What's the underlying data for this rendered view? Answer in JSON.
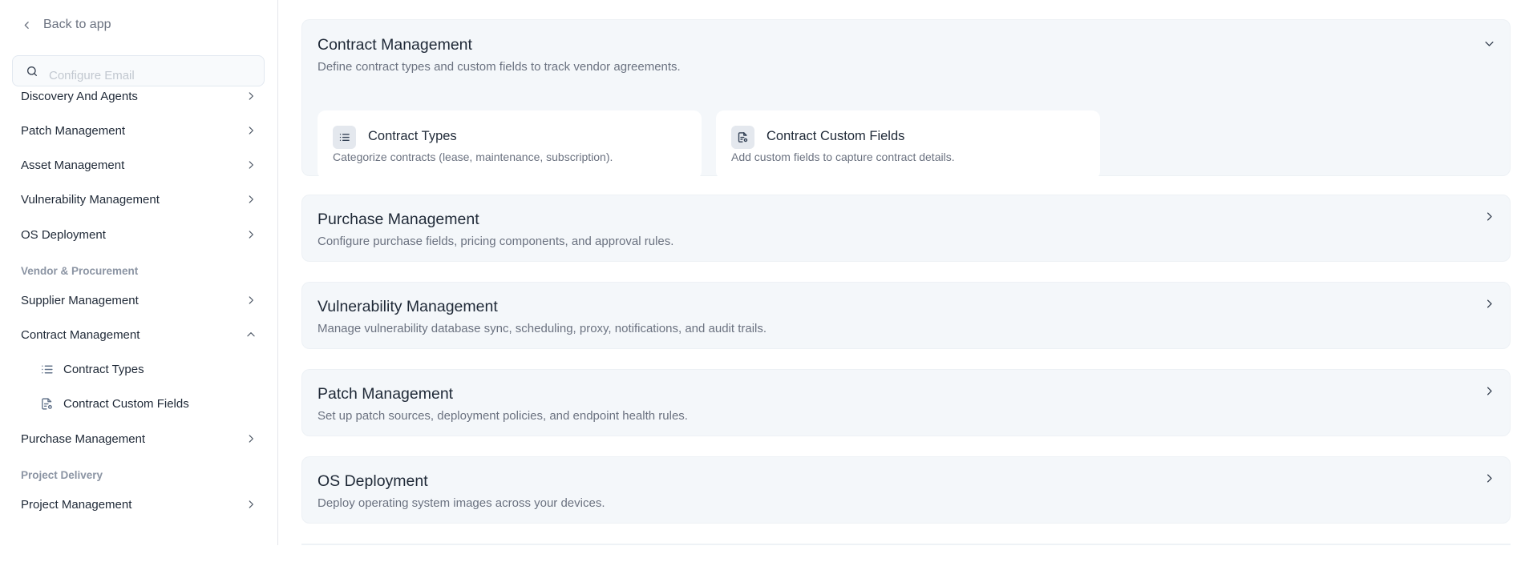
{
  "sidebar": {
    "back_label": "Back to app",
    "search_placeholder": "Configure Email",
    "items_top": [
      {
        "label": "Discovery And Agents"
      },
      {
        "label": "Patch Management"
      },
      {
        "label": "Asset Management"
      },
      {
        "label": "Vulnerability Management"
      },
      {
        "label": "OS Deployment"
      }
    ],
    "section_vendor": "Vendor & Procurement",
    "supplier": "Supplier Management",
    "contract": "Contract Management",
    "contract_sub": [
      {
        "label": "Contract Types",
        "icon": "list-icon"
      },
      {
        "label": "Contract Custom Fields",
        "icon": "file-settings-icon"
      }
    ],
    "purchase": "Purchase Management",
    "section_project": "Project Delivery",
    "project": "Project Management"
  },
  "main": {
    "panels": [
      {
        "title": "Contract Management",
        "description": "Define contract types and custom fields to track vendor agreements.",
        "expanded": true,
        "cards": [
          {
            "title": "Contract Types",
            "description": "Categorize contracts (lease, maintenance, subscription).",
            "icon": "list-icon"
          },
          {
            "title": "Contract Custom Fields",
            "description": "Add custom fields to capture contract details.",
            "icon": "file-settings-icon"
          }
        ]
      },
      {
        "title": "Purchase Management",
        "description": "Configure purchase fields, pricing components, and approval rules.",
        "expanded": false
      },
      {
        "title": "Vulnerability Management",
        "description": "Manage vulnerability database sync, scheduling, proxy, notifications, and audit trails.",
        "expanded": false
      },
      {
        "title": "Patch Management",
        "description": "Set up patch sources, deployment policies, and endpoint health rules.",
        "expanded": false
      },
      {
        "title": "OS Deployment",
        "description": "Deploy operating system images across your devices.",
        "expanded": false
      }
    ]
  }
}
